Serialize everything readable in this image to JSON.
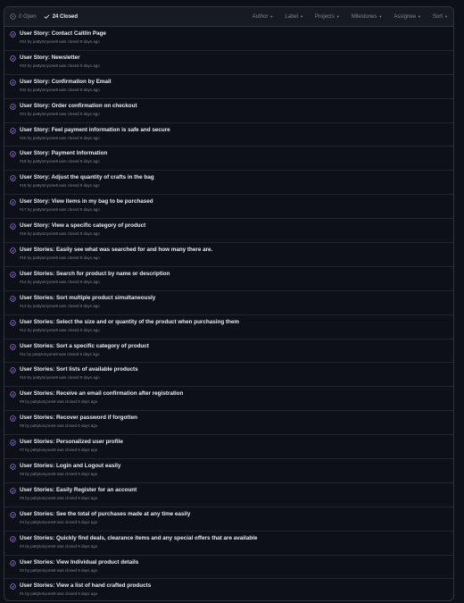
{
  "colors": {
    "closed_icon": "#a371f7",
    "muted": "#7d8590",
    "border": "#30363d"
  },
  "header": {
    "open_label": "0 Open",
    "closed_label": "24 Closed",
    "filters": [
      "Author",
      "Label",
      "Projects",
      "Milestones",
      "Assignee",
      "Sort"
    ]
  },
  "issues": [
    {
      "title": "User Story: Contact Caitlin Page",
      "meta": "#24 by pattytonyone8 was closed 9 days ago"
    },
    {
      "title": "User Story: Newsletter",
      "meta": "#23 by pattytonyone8 was closed 9 days ago"
    },
    {
      "title": "User Story: Confirmation by Email",
      "meta": "#22 by pattytonyone8 was closed 9 days ago"
    },
    {
      "title": "User Story: Order confirmation on checkout",
      "meta": "#21 by pattytonyone8 was closed 9 days ago"
    },
    {
      "title": "User Story: Feel payment information is safe and secure",
      "meta": "#20 by pattytonyone8 was closed 9 days ago"
    },
    {
      "title": "User Story: Payment Information",
      "meta": "#19 by pattytonyone8 was closed 9 days ago"
    },
    {
      "title": "User Story: Adjust the quantity of crafts in the bag",
      "meta": "#18 by pattytonyone8 was closed 9 days ago"
    },
    {
      "title": "User Story: View items in my bag to be purchased",
      "meta": "#17 by pattytonyone8 was closed 9 days ago"
    },
    {
      "title": "User Story: View a specific category of product",
      "meta": "#16 by pattytonyone8 was closed 9 days ago"
    },
    {
      "title": "User Stories: Easily see what was searched for and how many there are.",
      "meta": "#15 by pattytonyone8 was closed 9 days ago"
    },
    {
      "title": "User Stories: Search for product by name or description",
      "meta": "#14 by pattytonyone8 was closed 9 days ago"
    },
    {
      "title": "User Stories: Sort multiple product simultaneously",
      "meta": "#13 by pattytonyone8 was closed 9 days ago"
    },
    {
      "title": "User Stories: Select the size and or quantity of the product when purchasing them",
      "meta": "#12 by pattytonyone8 was closed 9 days ago"
    },
    {
      "title": "User Stories: Sort a specific category of product",
      "meta": "#11 by pattytonyone8 was closed 9 days ago"
    },
    {
      "title": "User Stories: Sort lists of available products",
      "meta": "#10 by pattytonyone8 was closed 9 days ago"
    },
    {
      "title": "User Stories: Receive an email confirmation after registration",
      "meta": "#9 by pattytonyone8 was closed 9 days ago"
    },
    {
      "title": "User Stories: Recover password if forgotten",
      "meta": "#8 by pattytonyone8 was closed 9 days ago"
    },
    {
      "title": "User Stories: Personalized user profile",
      "meta": "#7 by pattytonyone8 was closed 9 days ago"
    },
    {
      "title": "User Stories: Login and Logout easily",
      "meta": "#6 by pattytonyone8 was closed 9 days ago"
    },
    {
      "title": "User Stories: Easily Register for an account",
      "meta": "#5 by pattytonyone8 was closed 9 days ago"
    },
    {
      "title": "User Stories: See the total of purchases made at any time easily",
      "meta": "#4 by pattytonyone8 was closed 9 days ago"
    },
    {
      "title": "User Stories: Quickly find deals, clearance items and any special offers that are available",
      "meta": "#3 by pattytonyone8 was closed 9 days ago"
    },
    {
      "title": "User Stories: View Individual product details",
      "meta": "#2 by pattytonyone8 was closed 9 days ago"
    },
    {
      "title": "User Stories: View a list of hand crafted products",
      "meta": "#1 by pattytonyone8 was closed 9 days ago"
    }
  ]
}
